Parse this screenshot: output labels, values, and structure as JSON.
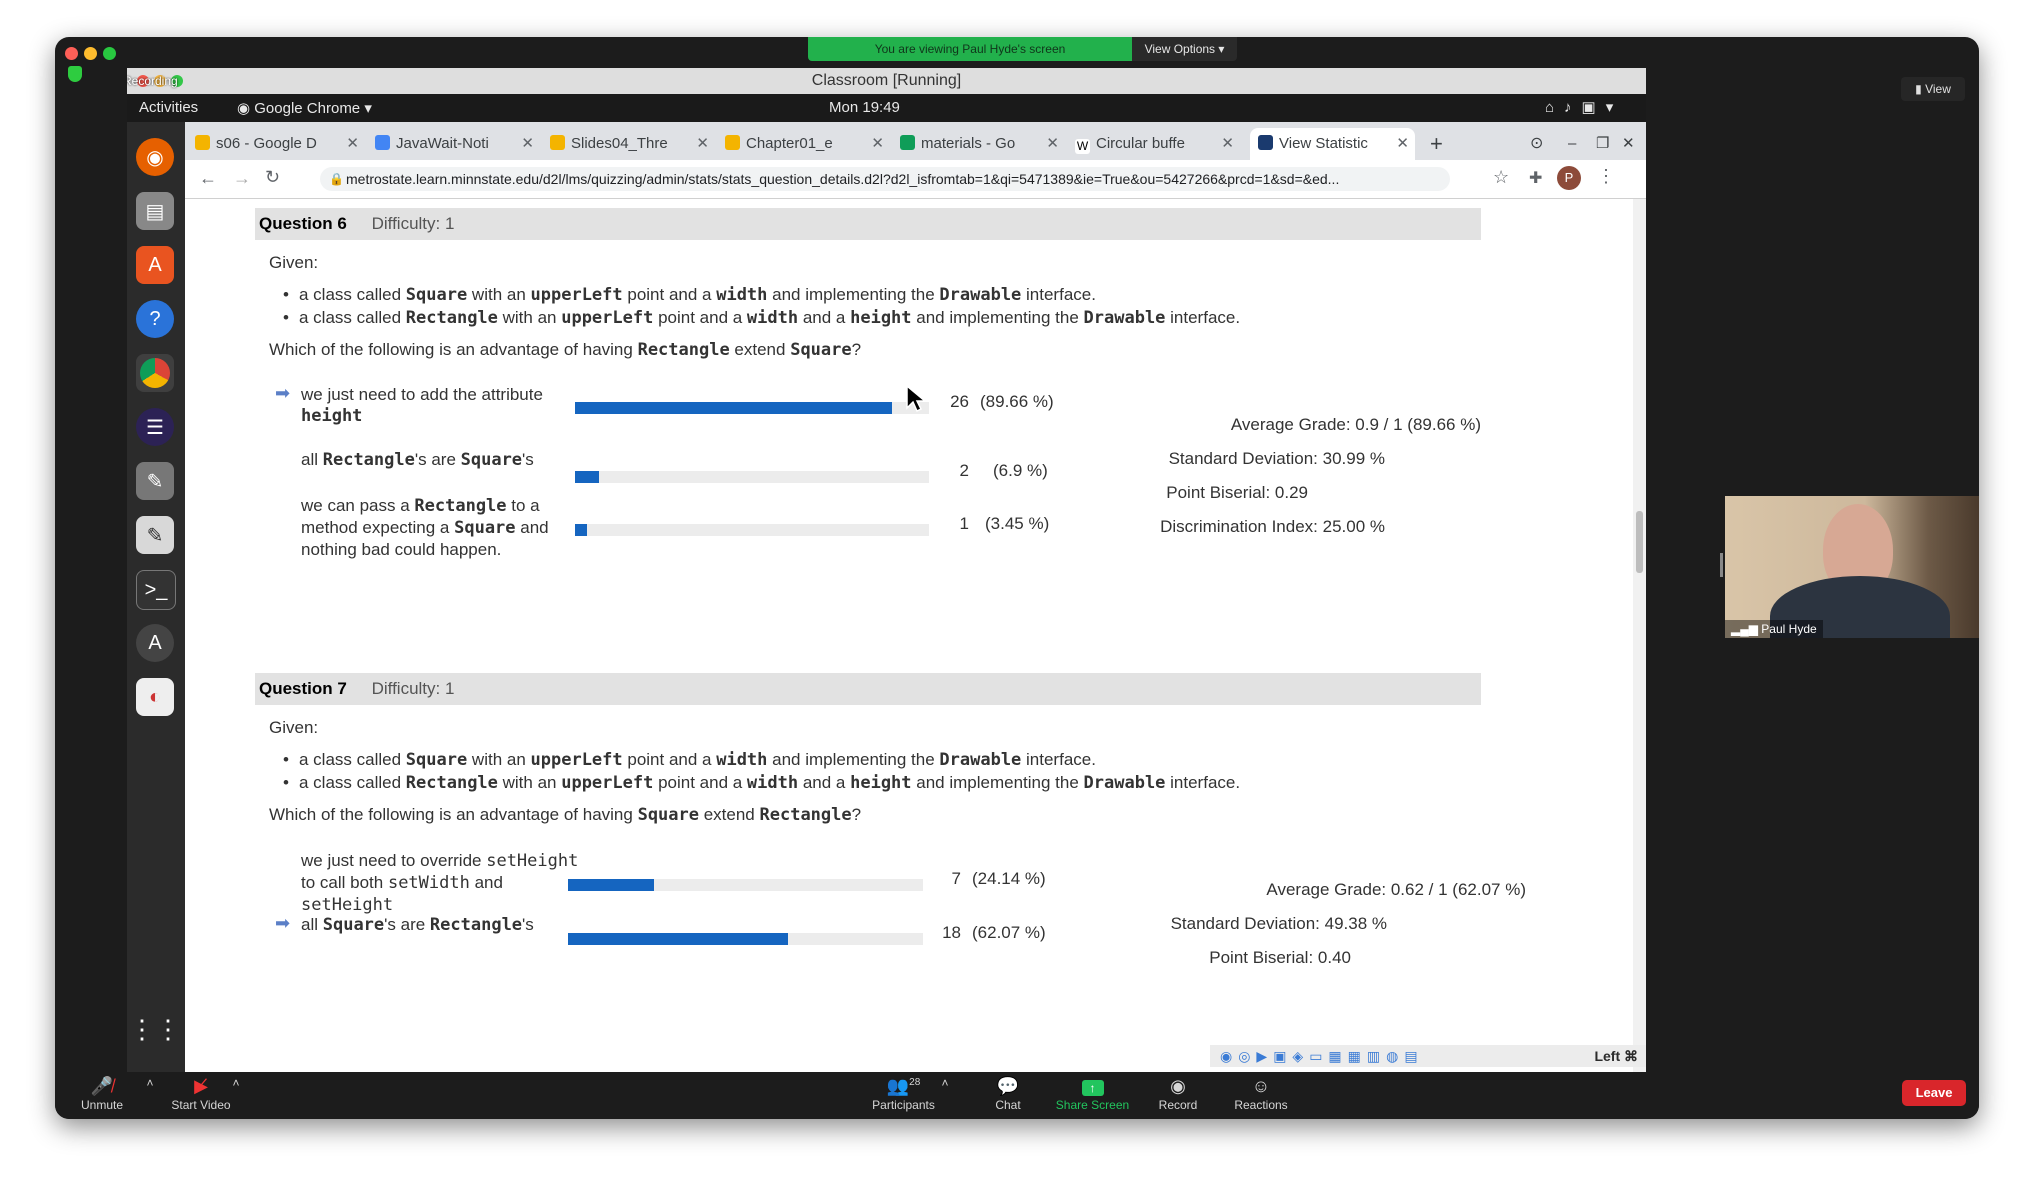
{
  "zoom": {
    "share_banner": "You are viewing Paul Hyde's screen",
    "view_options": "View Options",
    "view_button": "View",
    "recording": "Recording",
    "participant_name": "Paul Hyde",
    "toolbar": {
      "unmute": "Unmute",
      "start_video": "Start Video",
      "participants": "Participants",
      "participants_count": "28",
      "chat": "Chat",
      "share_screen": "Share Screen",
      "record": "Record",
      "reactions": "Reactions",
      "leave": "Leave"
    }
  },
  "vm": {
    "title": "Classroom [Running]",
    "activities": "Activities",
    "app_menu": "Google Chrome",
    "clock": "Mon 19:49",
    "host_key": "Left ⌘"
  },
  "browser": {
    "tabs": [
      {
        "label": "s06 - Google D"
      },
      {
        "label": "JavaWait-Noti"
      },
      {
        "label": "Slides04_Thre"
      },
      {
        "label": "Chapter01_e"
      },
      {
        "label": "materials - Go"
      },
      {
        "label": "Circular buffe"
      },
      {
        "label": "View Statistic"
      }
    ],
    "url": "metrostate.learn.minnstate.edu/d2l/lms/quizzing/admin/stats/stats_question_details.d2l?d2l_isfromtab=1&qi=5471389&ie=True&ou=5427266&prcd=1&sd=&ed...",
    "profile_initial": "P"
  },
  "questions": [
    {
      "number": "Question 6",
      "difficulty": "Difficulty: 1",
      "given": "Given:",
      "b1": {
        "t1": "a class called ",
        "c1": "Square",
        "t2": " with an ",
        "c2": "upperLeft",
        "t3": " point and a ",
        "c3": "width",
        "t4": " and implementing the ",
        "c4": "Drawable",
        "t5": " interface."
      },
      "b2": {
        "t1": "a class called ",
        "c1": "Rectangle",
        "t2": " with an ",
        "c2": "upperLeft",
        "t3": " point and a ",
        "c3": "width",
        "t4": " and a ",
        "c5": "height",
        "t6": " and implementing the ",
        "c4": "Drawable",
        "t5": " interface."
      },
      "prompt": {
        "t1": "Which of the following is an advantage of having ",
        "c1": "Rectangle",
        "t2": " extend ",
        "c2": "Square",
        "t3": "?"
      },
      "answers": [
        {
          "line1": "we just need to add the attribute",
          "code": "height",
          "count": "26",
          "pct": "(89.66 %)",
          "fraction": 0.8966,
          "correct": true
        },
        {
          "c1": "Rectangle",
          "t1": "'s are ",
          "c2": "Square",
          "t2": "'s",
          "count": "2",
          "pct": "(6.9 %)",
          "fraction": 0.069
        },
        {
          "t1": "we can pass a ",
          "c1": "Rectangle",
          "t2": " to a method expecting a ",
          "c2": "Square",
          "t3": " and nothing bad could happen.",
          "count": "1",
          "pct": "(3.45 %)",
          "fraction": 0.0345
        }
      ],
      "stats": {
        "average": "Average Grade: 0.9 / 1 (89.66 %)",
        "stddev": "Standard Deviation: 30.99 %",
        "biserial": "Point Biserial: 0.29",
        "discrimination": "Discrimination Index: 25.00 %"
      }
    },
    {
      "number": "Question 7",
      "difficulty": "Difficulty: 1",
      "given": "Given:",
      "b1": {
        "t1": "a class called ",
        "c1": "Square",
        "t2": " with an ",
        "c2": "upperLeft",
        "t3": " point and a ",
        "c3": "width",
        "t4": " and implementing the ",
        "c4": "Drawable",
        "t5": " interface."
      },
      "b2": {
        "t1": "a class called ",
        "c1": "Rectangle",
        "t2": " with an ",
        "c2": "upperLeft",
        "t3": " point and a ",
        "c3": "width",
        "t4": " and a ",
        "c5": "height",
        "t6": " and implementing the ",
        "c4": "Drawable",
        "t5": " interface."
      },
      "prompt": {
        "t1": "Which of the following is an advantage of having ",
        "c1": "Square",
        "t2": " extend ",
        "c2": "Rectangle",
        "t3": "?"
      },
      "answers": [
        {
          "t1": "we just need to override ",
          "c1": "setHeight",
          "t2": " to call both ",
          "c2": "setWidth",
          "t3": " and ",
          "c3": "setHeight",
          "count": "7",
          "pct": "(24.14 %)",
          "fraction": 0.2414
        },
        {
          "c1": "Square",
          "t1": "'s are ",
          "c2": "Rectangle",
          "t2": "'s",
          "count": "18",
          "pct": "(62.07 %)",
          "fraction": 0.6207,
          "correct": true
        }
      ],
      "stats": {
        "average": "Average Grade: 0.62 / 1 (62.07 %)",
        "stddev": "Standard Deviation: 49.38 %",
        "biserial": "Point Biserial: 0.40"
      }
    }
  ],
  "colors": {
    "bar": "#1565c0",
    "share_green": "#22b14c",
    "leave_red": "#d9262b"
  }
}
